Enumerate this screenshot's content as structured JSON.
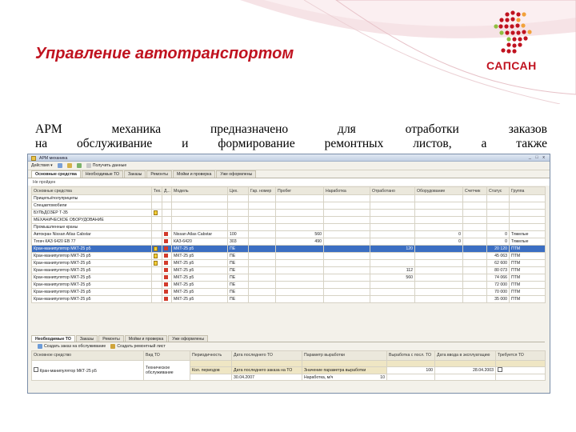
{
  "slide": {
    "title": "Управление автотранспортом",
    "logo_text": "САПСАН",
    "desc_line1": "АРМ механика предназначено для отработки заказов",
    "desc_line2": "на обслуживание и формирование ремонтных листов, а также"
  },
  "window": {
    "title": "АРМ механика",
    "controls": "_ □ x",
    "toolbar": {
      "actions_label": "Действия ▾",
      "refresh_label": "Получить данные"
    },
    "tabs": [
      "Основные средства",
      "Необходимые ТО",
      "Заказы",
      "Ремонты",
      "Мойки и проверка",
      "Уже оформлены"
    ],
    "filter_label": "Не пройден",
    "grid": {
      "columns": [
        "Основные средства",
        "Тех.",
        "Д...",
        "Модель",
        "Цех.",
        "Гар. номер",
        "Пробег",
        "Наработка",
        "Отработано",
        "Оборудование",
        "Счетчик",
        "Статус",
        "Группа"
      ],
      "rows": [
        {
          "type": "group",
          "name": "Прицепы/полуприцепы"
        },
        {
          "type": "group",
          "name": "Спецавтомобили"
        },
        {
          "type": "group",
          "name": "БУЛЬДОЗЕР Т-35",
          "flag": "y"
        },
        {
          "type": "group",
          "name": "МЕХАНИЧЕСКОЕ ОБОРУДОВАНИЕ"
        },
        {
          "type": "group",
          "name": "Промышленные краны"
        },
        {
          "type": "row",
          "name": "Автокран Nissan Atlas Cabstar",
          "model": "Nissan Atlas Cabstar",
          "tsex": "100",
          "garage": "",
          "probeg": "560",
          "narab": "",
          "otrab": "0",
          "status": "0",
          "group": "Тяжелые"
        },
        {
          "type": "row",
          "name": "Тягач КАЗ 6420 ЕВ 77",
          "model": "КАЗ-6420",
          "tsex": "303",
          "garage": "",
          "probeg": "490",
          "narab": "",
          "otrab": "0",
          "status": "0",
          "group": "Тяжелые"
        },
        {
          "type": "sel",
          "name": "Кран-манипулятор МКТ-25 р5",
          "flag": "y",
          "model": "МКТ-25 р5",
          "tsex": "ПЕ",
          "otrab": "",
          "oborud": "120",
          "schetchik": "",
          "status": "20 120",
          "group": "Территория",
          "extra": "ПТМ"
        },
        {
          "type": "row",
          "name": "Кран-манипулятор МКТ-25 р5",
          "flag": "y",
          "model": "МКТ-25 р5",
          "tsex": "ПЕ",
          "status": "45 063",
          "group": "Территория",
          "extra": "ПТМ"
        },
        {
          "type": "row",
          "name": "Кран-манипулятор МКТ-25 р5",
          "flag": "y",
          "model": "МКТ-25 р5",
          "tsex": "ПЕ",
          "status": "62 600",
          "group": "Территория",
          "extra": "ПТМ"
        },
        {
          "type": "row",
          "name": "Кран-манипулятор МКТ-25 р5",
          "model": "МКТ-25 р5",
          "tsex": "ПЕ",
          "status": "80 073",
          "group": "Территория",
          "extra": "ПТМ",
          "oborud": "112"
        },
        {
          "type": "row",
          "name": "Кран-манипулятор МКТ-25 р5",
          "model": "МКТ-25 р5",
          "tsex": "ПЕ",
          "status": "74 066",
          "group": "Территория",
          "extra": "ПТМ",
          "oborud": "560"
        },
        {
          "type": "row",
          "name": "Кран-манипулятор МКТ-25 р5",
          "model": "МКТ-25 р5",
          "tsex": "ПЕ",
          "status": "72 000",
          "group": "Территория",
          "extra": "ПТМ"
        },
        {
          "type": "row",
          "name": "Кран-манипулятор МКТ-25 р5",
          "model": "МКТ-25 р5",
          "tsex": "ПЕ",
          "status": "70 000",
          "group": "Территория",
          "extra": "ПТМ"
        },
        {
          "type": "row",
          "name": "Кран-манипулятор МКТ-25 р5",
          "model": "МКТ-25 р5",
          "tsex": "ПЕ",
          "status": "35 000",
          "group": "Территория",
          "extra": "ПТМ"
        }
      ]
    },
    "lower": {
      "tabs": [
        "Необходимые ТО",
        "Заказы",
        "Ремонты",
        "Мойки и проверка",
        "Уже оформлены"
      ],
      "create_label": "Создать заказ на обслуживание",
      "create2_label": "Создать ремонтный лист",
      "columns": [
        "Основное средство",
        "Вид ТО",
        "Периодичность",
        "Дата последнего ТО",
        "Параметр выработки",
        "Выработка с посл. ТО",
        "Дата ввода в эксплуатацию",
        "Требуется ТО"
      ],
      "row": {
        "name": "Кран-манипулятор МКТ-25 р5 ",
        "vid": "Техническое обслуживание",
        "period_label": "Кол. периодов",
        "date1_label": "Дата последнего заказа на ТО",
        "date1": "30.04.2007",
        "param_label": "Значение параметра выработки",
        "param": "Наработка",
        "vyrab": "100",
        "date2": "28.04.2003",
        "last_date": "23.02.2007",
        "param2": "Наработка, м/ч",
        "val2": "10"
      }
    }
  }
}
